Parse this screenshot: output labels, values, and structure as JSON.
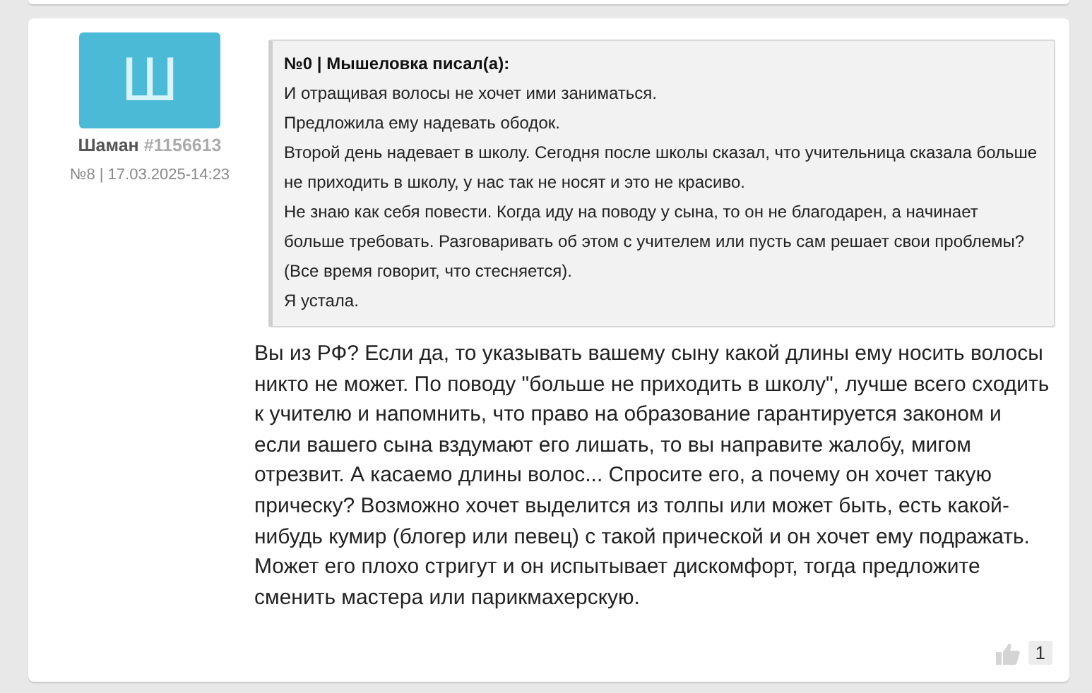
{
  "post": {
    "avatar_letter": "Ш",
    "author": "Шаман",
    "author_id": "#1156613",
    "meta": "№8 | 17.03.2025-14:23",
    "quote": {
      "header": "№0 | Мышеловка писал(а):",
      "lines": [
        "И отращивая волосы не хочет ими заниматься.",
        "Предложила ему надевать ободок.",
        "Второй день надевает в школу. Сегодня после школы сказал, что учительница сказала больше не приходить в школу, у нас так не носят и это не красиво.",
        "Не знаю как себя повести. Когда иду на поводу у сына, то он не благодарен, а начинает больше требовать. Разговаривать об этом с учителем или пусть сам решает свои проблемы? (Все время говорит, что стесняется).",
        "Я устала."
      ]
    },
    "text": "Вы из РФ? Если да, то указывать вашему сыну какой длины ему носить волосы никто не может. По поводу \"больше не приходить в школу\", лучше всего сходить к учителю и напомнить, что право на образование гарантируется законом и если вашего сына вздумают его лишать, то вы направите жалобу, мигом отрезвит. А касаемо длины волос... Спросите его, а почему он хочет такую прическу? Возможно хочет выделится из толпы или может быть, есть какой-нибудь кумир (блогер или певец) с такой прической и он хочет ему подражать. Может его плохо стригут и он испытывает дискомфорт, тогда предложите сменить мастера или парикмахерскую.",
    "likes": "1"
  }
}
